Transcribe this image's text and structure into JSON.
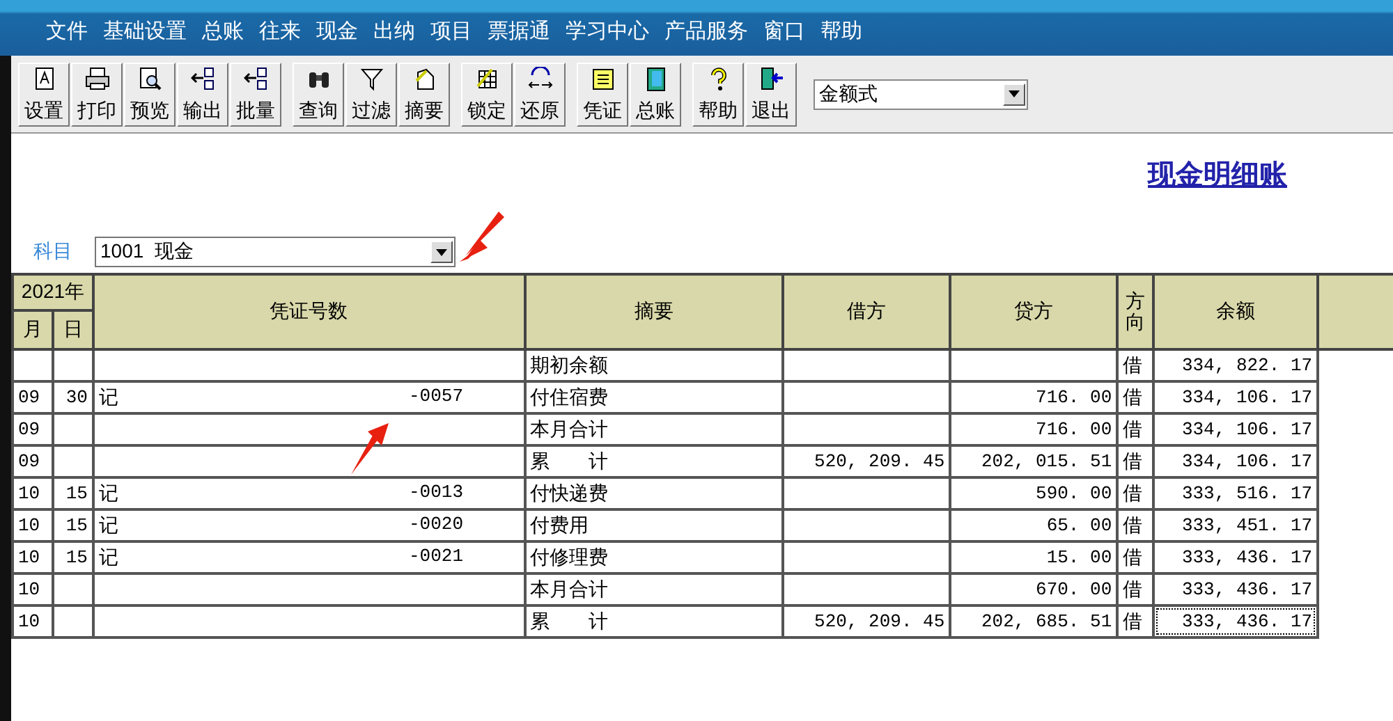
{
  "menu": [
    "文件",
    "基础设置",
    "总账",
    "往来",
    "现金",
    "出纳",
    "项目",
    "票据通",
    "学习中心",
    "产品服务",
    "窗口",
    "帮助"
  ],
  "toolbar": [
    [
      {
        "label": "设置"
      },
      {
        "label": "打印"
      },
      {
        "label": "预览"
      },
      {
        "label": "输出"
      },
      {
        "label": "批量"
      }
    ],
    [
      {
        "label": "查询"
      },
      {
        "label": "过滤"
      },
      {
        "label": "摘要"
      }
    ],
    [
      {
        "label": "锁定"
      },
      {
        "label": "还原"
      }
    ],
    [
      {
        "label": "凭证"
      },
      {
        "label": "总账"
      }
    ],
    [
      {
        "label": "帮助"
      },
      {
        "label": "退出"
      }
    ]
  ],
  "format_select": {
    "value": "金额式"
  },
  "title": "现金明细账",
  "subject": {
    "label": "科目",
    "value": "1001  现金"
  },
  "table": {
    "year_header": "2021年",
    "columns": {
      "month": "月",
      "day": "日",
      "voucher": "凭证号数",
      "summary": "摘要",
      "debit": "借方",
      "credit": "贷方",
      "direction": "方向",
      "balance": "余额"
    },
    "rows": [
      {
        "month": "",
        "day": "",
        "voucher_type": "",
        "voucher_no": "",
        "summary": "期初余额",
        "debit": "",
        "credit": "",
        "direction": "借",
        "balance": "334, 822. 17",
        "focused": false
      },
      {
        "month": "09",
        "day": "30",
        "voucher_type": "记",
        "voucher_no": "-0057",
        "summary": "付住宿费",
        "debit": "",
        "credit": "716. 00",
        "direction": "借",
        "balance": "334, 106. 17",
        "focused": false
      },
      {
        "month": "09",
        "day": "",
        "voucher_type": "",
        "voucher_no": "",
        "summary": "本月合计",
        "debit": "",
        "credit": "716. 00",
        "direction": "借",
        "balance": "334, 106. 17",
        "focused": false
      },
      {
        "month": "09",
        "day": "",
        "voucher_type": "",
        "voucher_no": "",
        "summary": "累　　计",
        "debit": "520, 209. 45",
        "credit": "202, 015. 51",
        "direction": "借",
        "balance": "334, 106. 17",
        "focused": false
      },
      {
        "month": "10",
        "day": "15",
        "voucher_type": "记",
        "voucher_no": "-0013",
        "summary": "付快递费",
        "debit": "",
        "credit": "590. 00",
        "direction": "借",
        "balance": "333, 516. 17",
        "focused": false
      },
      {
        "month": "10",
        "day": "15",
        "voucher_type": "记",
        "voucher_no": "-0020",
        "summary": "付费用",
        "debit": "",
        "credit": "65. 00",
        "direction": "借",
        "balance": "333, 451. 17",
        "focused": false
      },
      {
        "month": "10",
        "day": "15",
        "voucher_type": "记",
        "voucher_no": "-0021",
        "summary": "付修理费",
        "debit": "",
        "credit": "15. 00",
        "direction": "借",
        "balance": "333, 436. 17",
        "focused": false
      },
      {
        "month": "10",
        "day": "",
        "voucher_type": "",
        "voucher_no": "",
        "summary": "本月合计",
        "debit": "",
        "credit": "670. 00",
        "direction": "借",
        "balance": "333, 436. 17",
        "focused": false
      },
      {
        "month": "10",
        "day": "",
        "voucher_type": "",
        "voucher_no": "",
        "summary": "累　　计",
        "debit": "520, 209. 45",
        "credit": "202, 685. 51",
        "direction": "借",
        "balance": "333, 436. 17",
        "focused": true
      }
    ]
  }
}
